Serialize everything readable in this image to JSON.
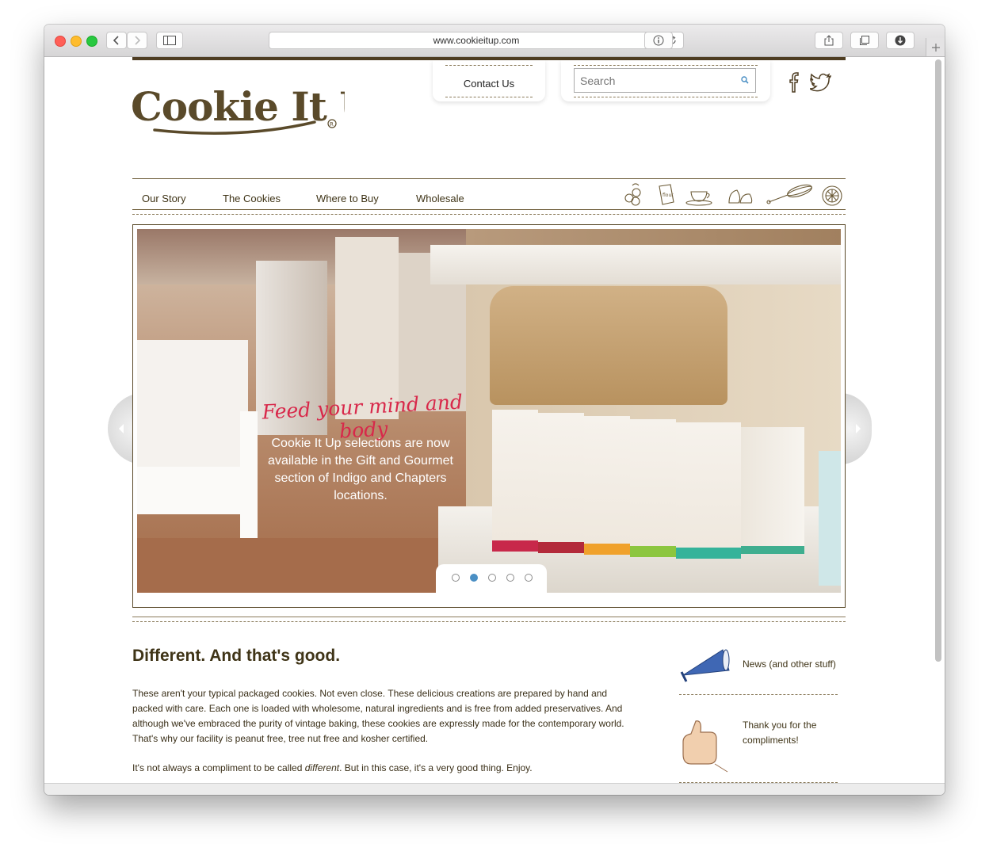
{
  "browser": {
    "url": "www.cookieitup.com"
  },
  "site": {
    "logo_text": "Cookie It Up",
    "contact_label": "Contact Us",
    "search_placeholder": "Search",
    "nav": [
      "Our Story",
      "The Cookies",
      "Where to Buy",
      "Wholesale"
    ],
    "social": [
      "facebook-icon",
      "twitter-icon"
    ],
    "category_icons": [
      "blueberries-icon",
      "flour-bag-icon",
      "teacup-icon",
      "chocolate-chips-icon",
      "whisk-icon",
      "lemon-slice-icon"
    ]
  },
  "hero": {
    "script_line": "Feed your mind and body",
    "message": "Cookie It Up selections are now available in the Gift and Gourmet section of Indigo and Chapters locations.",
    "slides": 5,
    "active_slide": 2
  },
  "intro": {
    "heading": "Different. And that's good.",
    "paragraph1": "These aren't your typical packaged cookies. Not even close. These delicious creations are prepared by hand and packed with care. Each one is loaded with wholesome, natural ingredients and is free from added preservatives. And although we've embraced the purity of vintage baking, these cookies are expressly made for the contemporary world. That's why our facility is peanut free, tree nut free and kosher certified.",
    "paragraph2_pre": "It's not always a compliment to be called ",
    "paragraph2_em": "different",
    "paragraph2_post": ". But in this case, it's a very good thing. Enjoy."
  },
  "sidebar": {
    "news_label": "News (and other stuff)",
    "compliments_label": "Thank you for the compliments!"
  },
  "colors": {
    "brand_brown": "#5a4a2a",
    "script_red": "#d8284a",
    "slider_dot_active": "#4a8fc4"
  }
}
